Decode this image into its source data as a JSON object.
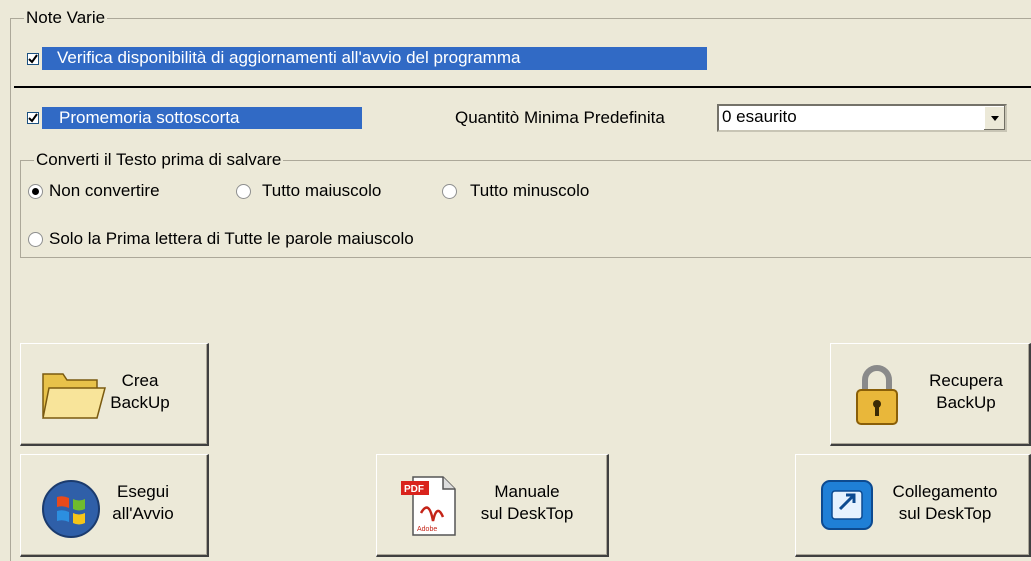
{
  "note_group": {
    "title": "Note Varie",
    "updates_check_label": "Verifica disponibilità di aggiornamenti all'avvio del programma",
    "updates_checked": true
  },
  "understock": {
    "label": "Promemoria sottoscorta",
    "checked": true,
    "min_qty_label": "Quantitò Minima Predefinita",
    "min_qty_value": "0 esaurito"
  },
  "convert_group": {
    "title": "Converti il Testo prima di salvare",
    "options": [
      {
        "label": "Non convertire",
        "selected": true
      },
      {
        "label": "Tutto maiuscolo",
        "selected": false
      },
      {
        "label": "Tutto minuscolo",
        "selected": false
      },
      {
        "label": "Solo la Prima lettera di Tutte le parole maiuscolo",
        "selected": false
      }
    ]
  },
  "buttons": {
    "create_backup": {
      "line1": "Crea",
      "line2": "BackUp",
      "icon": "folder-icon"
    },
    "restore_backup": {
      "line1": "Recupera",
      "line2": "BackUp",
      "icon": "padlock-icon"
    },
    "run_at_startup": {
      "line1": "Esegui",
      "line2": "all'Avvio",
      "icon": "windows-icon"
    },
    "manual_desktop": {
      "line1": "Manuale",
      "line2": "sul DeskTop",
      "icon": "pdf-icon"
    },
    "shortcut_desktop": {
      "line1": "Collegamento",
      "line2": "sul DeskTop",
      "icon": "shortcut-icon"
    }
  },
  "colors": {
    "highlight": "#316ac5",
    "face": "#ece9d8"
  }
}
